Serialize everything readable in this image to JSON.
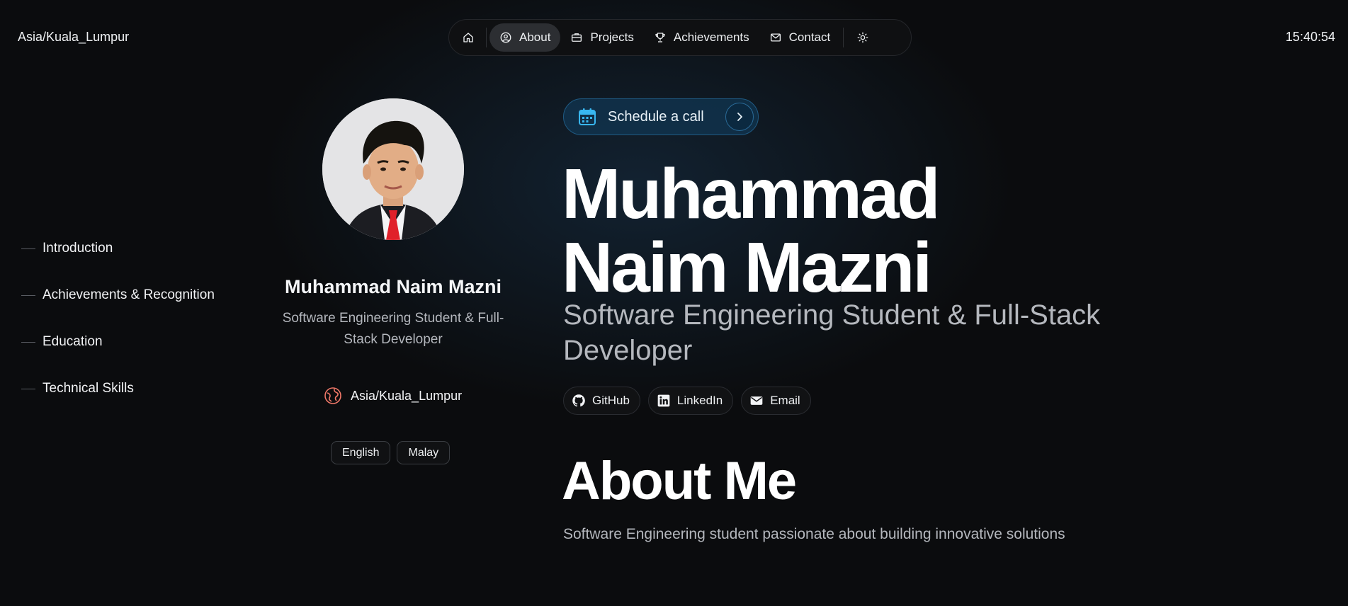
{
  "header": {
    "timezone": "Asia/Kuala_Lumpur",
    "clock": "15:40:54"
  },
  "nav": {
    "items": [
      {
        "icon": "home-icon",
        "label": ""
      },
      {
        "icon": "user-circle-icon",
        "label": "About",
        "active": true
      },
      {
        "icon": "briefcase-icon",
        "label": "Projects"
      },
      {
        "icon": "trophy-icon",
        "label": "Achievements"
      },
      {
        "icon": "mail-icon",
        "label": "Contact"
      }
    ],
    "theme_icon": "sun-icon"
  },
  "anchors": [
    {
      "label": "Introduction"
    },
    {
      "label": "Achievements & Recognition"
    },
    {
      "label": "Education"
    },
    {
      "label": "Technical Skills"
    }
  ],
  "profile": {
    "name": "Muhammad Naim Mazni",
    "role": "Software Engineering Student & Full-Stack Developer",
    "timezone": "Asia/Kuala_Lumpur",
    "languages": [
      "English",
      "Malay"
    ]
  },
  "hero": {
    "schedule_label": "Schedule a call",
    "name_line1": "Muhammad",
    "name_line2": "Naim Mazni",
    "role": "Software Engineering Student & Full-Stack Developer",
    "socials": [
      {
        "icon": "github-icon",
        "label": "GitHub"
      },
      {
        "icon": "linkedin-icon",
        "label": "LinkedIn"
      },
      {
        "icon": "email-icon",
        "label": "Email"
      }
    ]
  },
  "about": {
    "title": "About Me",
    "text": "Software Engineering student passionate about building innovative solutions"
  },
  "colors": {
    "accent": "#1f5a83",
    "calendar_icon": "#38b6f0",
    "globe_icon": "#f07868",
    "tie": "#e0202a"
  }
}
